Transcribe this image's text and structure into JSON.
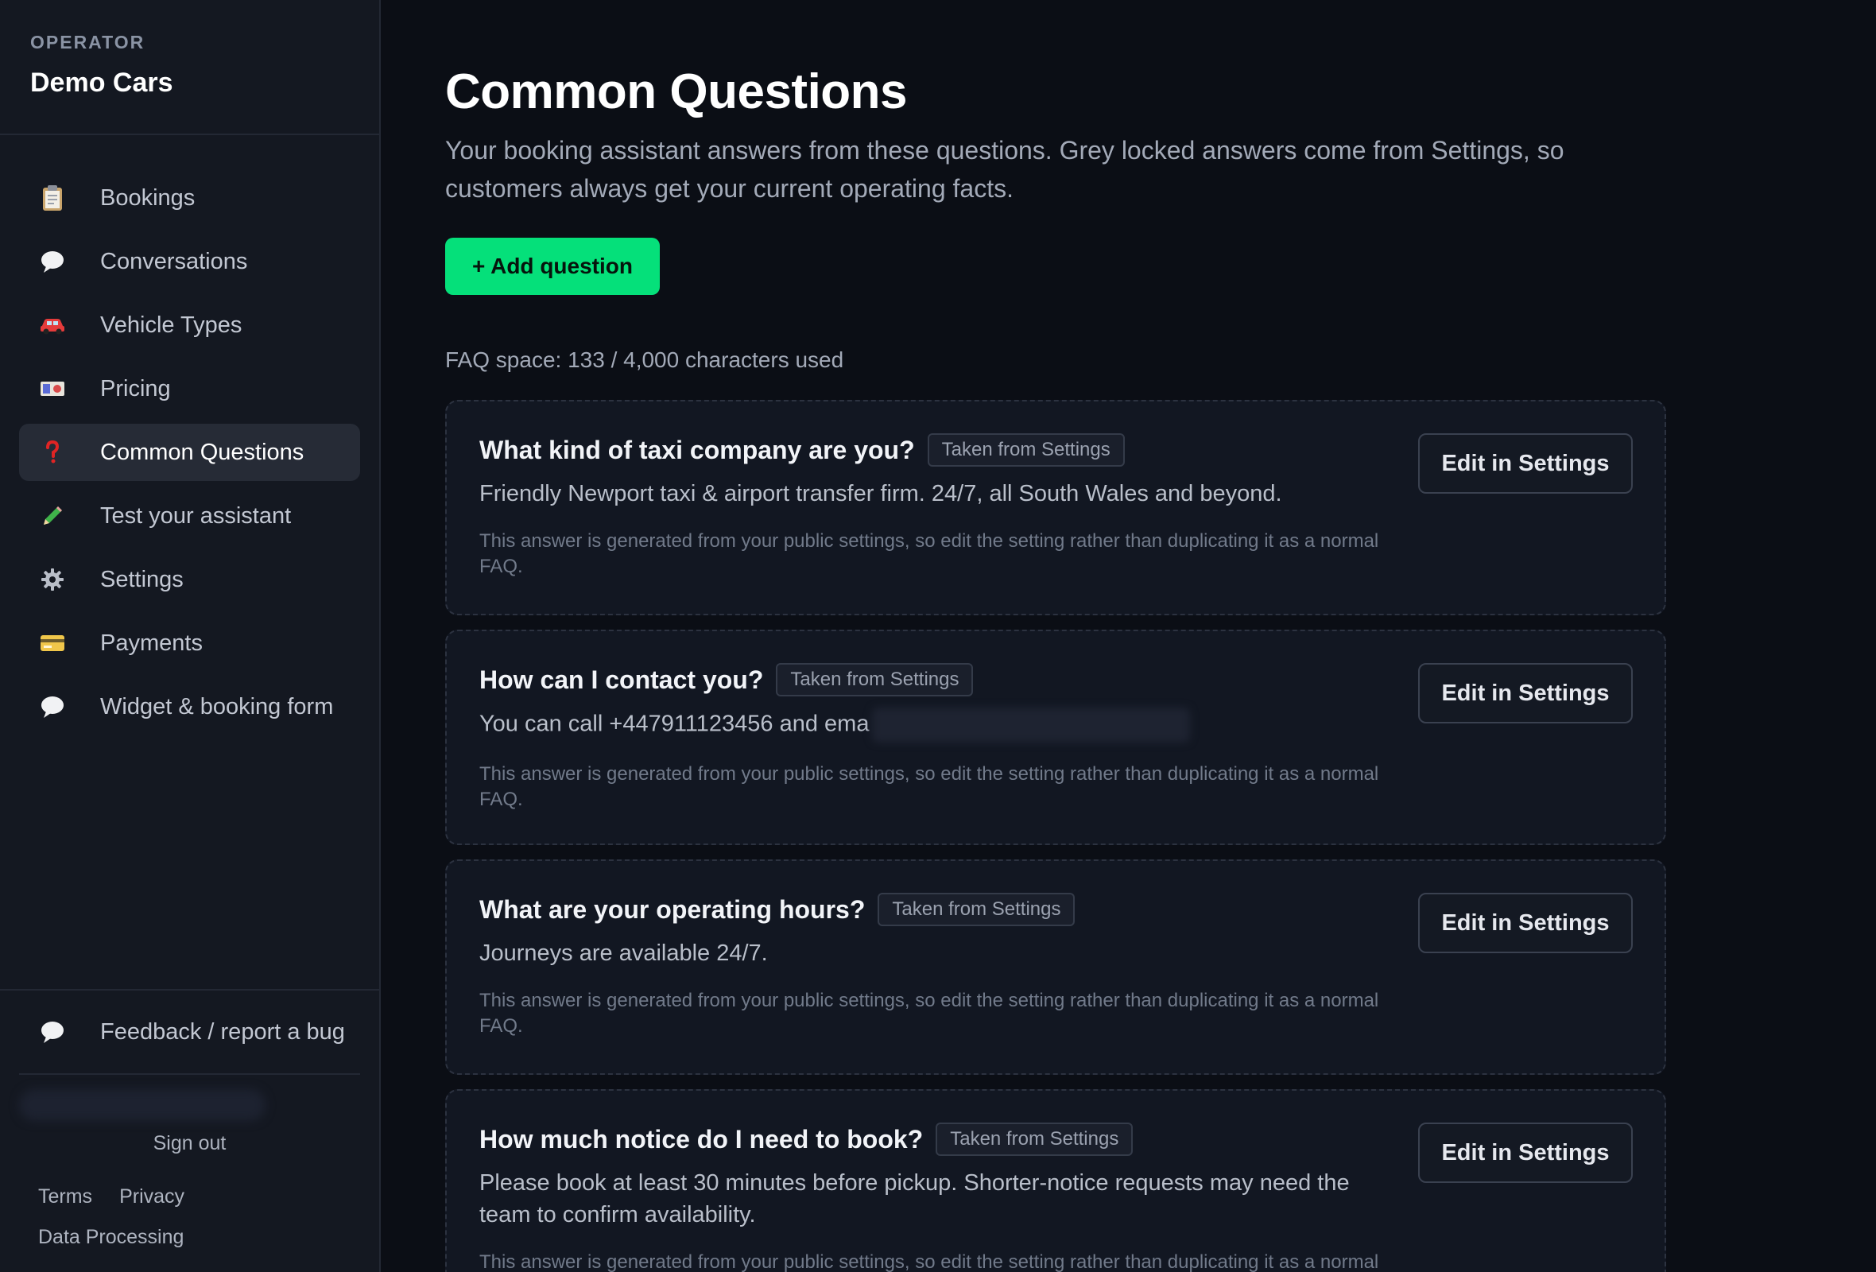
{
  "operator": {
    "label": "OPERATOR",
    "name": "Demo Cars"
  },
  "nav": [
    {
      "label": "Bookings",
      "icon": "clipboard-icon"
    },
    {
      "label": "Conversations",
      "icon": "speech-bubble-icon"
    },
    {
      "label": "Vehicle Types",
      "icon": "car-icon"
    },
    {
      "label": "Pricing",
      "icon": "banknote-icon"
    },
    {
      "label": "Common Questions",
      "icon": "question-mark-icon",
      "active": true
    },
    {
      "label": "Test your assistant",
      "icon": "pencil-icon"
    },
    {
      "label": "Settings",
      "icon": "gear-icon"
    },
    {
      "label": "Payments",
      "icon": "credit-card-icon"
    },
    {
      "label": "Widget & booking form",
      "icon": "speech-bubble-icon"
    }
  ],
  "footer": {
    "feedback_label": "Feedback / report a bug",
    "sign_out": "Sign out",
    "terms": "Terms",
    "privacy": "Privacy",
    "data_processing": "Data Processing"
  },
  "page": {
    "title": "Common Questions",
    "description": "Your booking assistant answers from these questions. Grey locked answers come from Settings, so customers always get your current operating facts.",
    "add_button": "+ Add question",
    "faq_space": "FAQ space: 133 / 4,000 characters used"
  },
  "faqs": [
    {
      "question": "What kind of taxi company are you?",
      "badge": "Taken from Settings",
      "answer": "Friendly Newport taxi & airport transfer firm. 24/7, all South Wales and beyond.",
      "note": "This answer is generated from your public settings, so edit the setting rather than duplicating it as a normal FAQ.",
      "edit_label": "Edit in Settings"
    },
    {
      "question": "How can I contact you?",
      "badge": "Taken from Settings",
      "answer": "You can call +447911123456 and ema",
      "note": "This answer is generated from your public settings, so edit the setting rather than duplicating it as a normal FAQ.",
      "edit_label": "Edit in Settings"
    },
    {
      "question": "What are your operating hours?",
      "badge": "Taken from Settings",
      "answer": "Journeys are available 24/7.",
      "note": "This answer is generated from your public settings, so edit the setting rather than duplicating it as a normal FAQ.",
      "edit_label": "Edit in Settings"
    },
    {
      "question": "How much notice do I need to book?",
      "badge": "Taken from Settings",
      "answer": "Please book at least 30 minutes before pickup. Shorter-notice requests may need the team to confirm availability.",
      "note": "This answer is generated from your public settings, so edit the setting rather than duplicating it as a normal FAQ.",
      "edit_label": "Edit in Settings"
    }
  ],
  "colors": {
    "background": "#0b0e15",
    "sidebar": "#141821",
    "accent": "#05e07a",
    "card": "#121722"
  }
}
